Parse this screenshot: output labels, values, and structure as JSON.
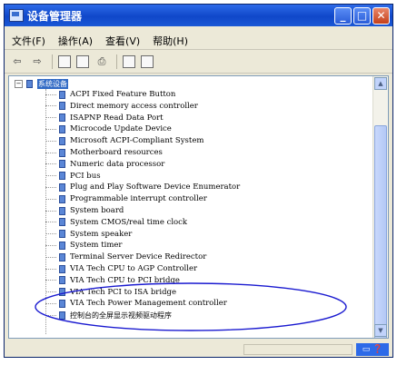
{
  "window": {
    "title": "设备管理器"
  },
  "menu": [
    {
      "label": "文件(F)"
    },
    {
      "label": "操作(A)"
    },
    {
      "label": "查看(V)"
    },
    {
      "label": "帮助(H)"
    }
  ],
  "tree": {
    "root": "系统设备",
    "root_expander": "−",
    "items": [
      {
        "label": "ACPI Fixed Feature Button"
      },
      {
        "label": "Direct memory access controller"
      },
      {
        "label": "ISAPNP Read Data Port"
      },
      {
        "label": "Microcode Update Device"
      },
      {
        "label": "Microsoft ACPI-Compliant System"
      },
      {
        "label": "Motherboard resources"
      },
      {
        "label": "Numeric data processor"
      },
      {
        "label": "PCI bus"
      },
      {
        "label": "Plug and Play Software Device Enumerator"
      },
      {
        "label": "Programmable interrupt controller"
      },
      {
        "label": "System board"
      },
      {
        "label": "System CMOS/real time clock"
      },
      {
        "label": "System speaker"
      },
      {
        "label": "System timer"
      },
      {
        "label": "Terminal Server Device Redirector"
      },
      {
        "label": "VIA Tech CPU to AGP Controller"
      },
      {
        "label": "VIA Tech CPU to PCI bridge"
      },
      {
        "label": "VIA Tech PCI to ISA bridge"
      },
      {
        "label": "VIA Tech Power Management controller"
      },
      {
        "label": "控制台的全屏显示视频驱动程序"
      }
    ]
  },
  "scroll": {
    "up": "▲",
    "down": "▼"
  },
  "annotation_color": "#1a1ad0"
}
